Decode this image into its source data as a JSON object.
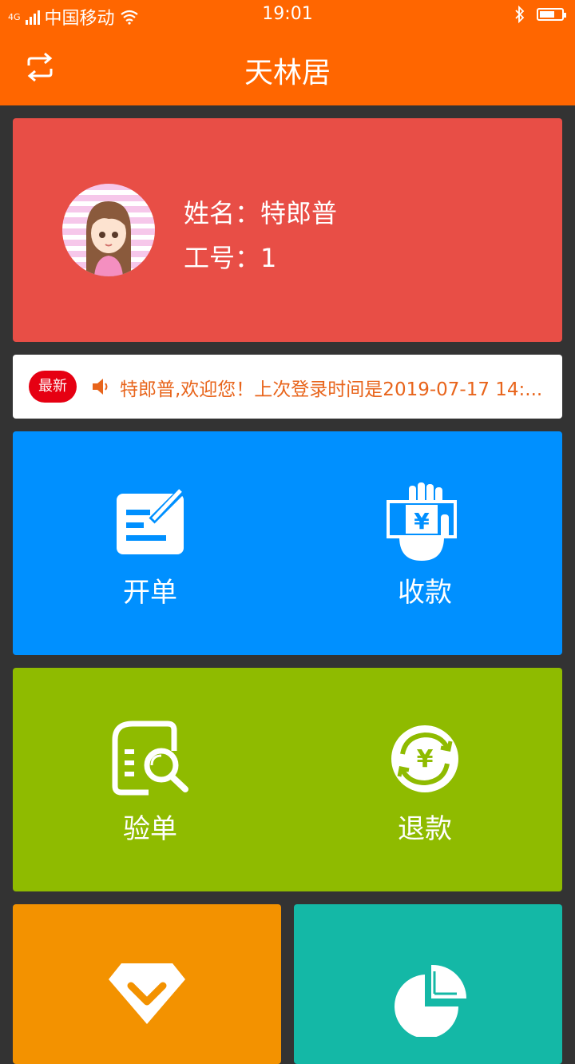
{
  "status_bar": {
    "network": "4G",
    "carrier": "中国移动",
    "time": "19:01",
    "battery_level": 0.7
  },
  "header": {
    "title": "天林居",
    "left_icon": "refresh-icon"
  },
  "profile": {
    "name_text": "姓名：特郎普",
    "id_text": "工号：1"
  },
  "notice": {
    "badge": "最新",
    "message": "特郎普,欢迎您！上次登录时间是2019-07-17 14:..."
  },
  "tiles": [
    {
      "label": "开单",
      "icon": "create-order-icon"
    },
    {
      "label": "收款",
      "icon": "payment-icon"
    },
    {
      "label": "验单",
      "icon": "verify-order-icon"
    },
    {
      "label": "退款",
      "icon": "refund-icon"
    },
    {
      "label": "",
      "icon": "diamond-icon"
    },
    {
      "label": "",
      "icon": "pie-chart-icon"
    }
  ],
  "colors": {
    "header": "#ff6600",
    "profile_card": "#e84e46",
    "tile_blue": "#0090ff",
    "tile_green": "#8fbb00",
    "tile_orange": "#f39200",
    "tile_teal": "#14b8a6",
    "badge": "#e60012",
    "notice_text": "#e8641b"
  }
}
